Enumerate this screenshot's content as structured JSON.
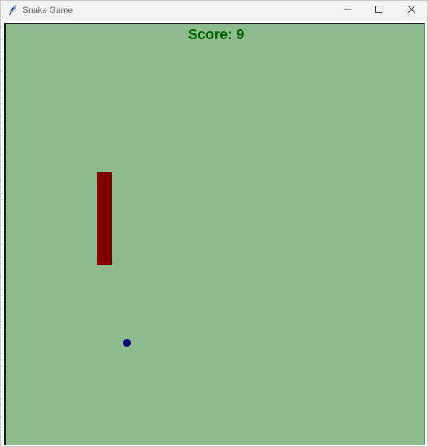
{
  "window": {
    "title": "Snake Game",
    "icon": "feather-icon",
    "controls": [
      "minimize-icon",
      "maximize-icon",
      "close-icon"
    ]
  },
  "game": {
    "score_text": "Score: 9",
    "score": 9,
    "background_color": "#8fbc8f",
    "score_color": "#006400",
    "snake_color": "#800000",
    "food_color": "#000080"
  }
}
